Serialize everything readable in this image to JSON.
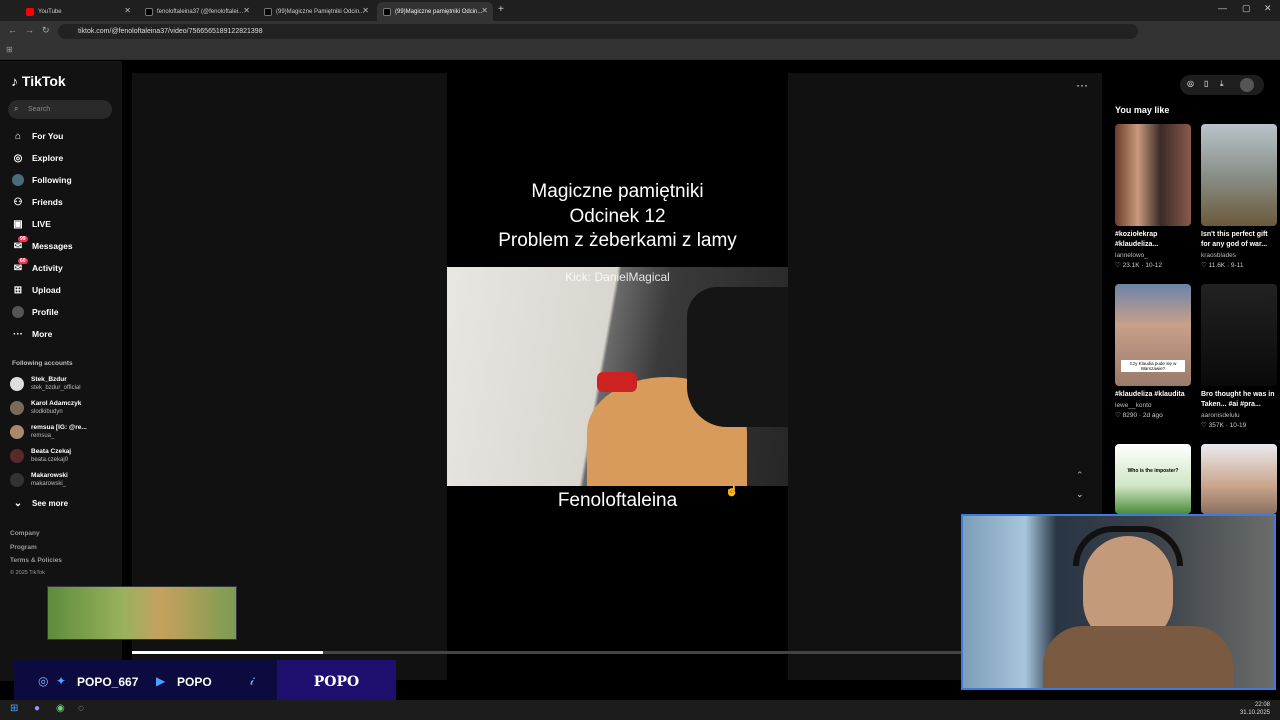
{
  "browser": {
    "tabs": [
      {
        "title": "YouTube",
        "color": "#ff0000"
      },
      {
        "title": "fenoloftaleina37 (@fenoloftalei...",
        "color": "#000000"
      },
      {
        "title": "(99)Magiczne Pamiętniki Odcin...",
        "color": "#000000"
      },
      {
        "title": "(99)Magiczne pamiętniki Odcin...",
        "color": "#000000"
      }
    ],
    "url": "tiktok.com/@fenoloftaleina37/video/7566565189122821398"
  },
  "sidebar": {
    "logo": "TikTok",
    "search_placeholder": "Search",
    "nav": [
      {
        "label": "For You",
        "icon": "home-icon"
      },
      {
        "label": "Explore",
        "icon": "compass-icon"
      },
      {
        "label": "Following",
        "icon": "avatar-icon"
      },
      {
        "label": "Friends",
        "icon": "friends-icon"
      },
      {
        "label": "LIVE",
        "icon": "live-icon"
      },
      {
        "label": "Messages",
        "icon": "messages-icon",
        "badge": "99"
      },
      {
        "label": "Activity",
        "icon": "activity-icon",
        "badge": "60"
      },
      {
        "label": "Upload",
        "icon": "upload-icon"
      },
      {
        "label": "Profile",
        "icon": "profile-icon"
      },
      {
        "label": "More",
        "icon": "more-icon"
      }
    ],
    "following_header": "Following accounts",
    "accounts": [
      {
        "name": "Stek_Bzdur",
        "handle": "stek_bzdur_official"
      },
      {
        "name": "Karol Adamczyk",
        "handle": "slodkibudyn"
      },
      {
        "name": "remsua [IG: @re...",
        "handle": "remsua_"
      },
      {
        "name": "Beata Czekaj",
        "handle": "beata.czekaj0"
      },
      {
        "name": "Makarowski",
        "handle": "makarowski_"
      }
    ],
    "see_more": "See more",
    "footer": [
      "Company",
      "Program",
      "Terms & Policies",
      "© 2025 TikTok"
    ]
  },
  "video": {
    "title_lines": [
      "Magiczne pamiętniki",
      "Odcinek 12",
      "Problem z żeberkami z lamy"
    ],
    "watermark": "Kick: DanielMagical",
    "caption": "Fenoloftaleina",
    "progress": 0.23
  },
  "right_panel": {
    "header": "You may like",
    "cards": [
      {
        "title": "#koziołekrap #klaudeliza...",
        "user": "lannelowo_",
        "stats": "23.1K · 10-12"
      },
      {
        "title": "Isn't this perfect gift for any god of war...",
        "user": "kraosblades",
        "stats": "11.6K · 9-11"
      },
      {
        "title": "#klaudeliza #klaudita",
        "user": "lewe__konto",
        "stats": "8290 · 2d ago"
      },
      {
        "title": "Bro thought he was in Taken... #ai #pra...",
        "user": "aaronisdelulu",
        "stats": "357K · 10-19"
      },
      {
        "title": "",
        "user": "",
        "stats": ""
      },
      {
        "title": "",
        "user": "",
        "stats": ""
      }
    ],
    "card3_overlay": "Czy Klaudia pude się w Warszawie?",
    "card5_overlay": "Who is the imposter?"
  },
  "overlay": {
    "instagram_handle": "POPO_667",
    "youtube_handle": "POPO",
    "brand": "POPO"
  },
  "taskbar": {
    "time": "22:08",
    "date": "31.10.2025"
  }
}
